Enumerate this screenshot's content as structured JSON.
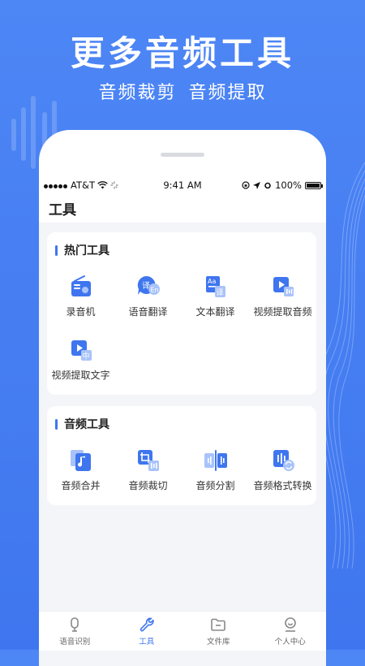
{
  "banner": {
    "title": "更多音频工具",
    "subtitle": "音频裁剪 音频提取"
  },
  "status_bar": {
    "carrier": "AT&T",
    "time": "9:41 AM",
    "battery": "100%"
  },
  "app_bar": {
    "title": "工具"
  },
  "sections": [
    {
      "title": "热门工具",
      "tools": [
        {
          "label": "录音机",
          "icon": "radio-recorder-icon"
        },
        {
          "label": "语音翻译",
          "icon": "speech-translate-icon"
        },
        {
          "label": "文本翻译",
          "icon": "text-translate-icon"
        },
        {
          "label": "视频提取音频",
          "icon": "video-extract-audio-icon"
        },
        {
          "label": "视频提取文字",
          "icon": "video-extract-text-icon"
        }
      ]
    },
    {
      "title": "音频工具",
      "tools": [
        {
          "label": "音频合并",
          "icon": "audio-merge-icon"
        },
        {
          "label": "音频裁切",
          "icon": "audio-crop-icon"
        },
        {
          "label": "音频分割",
          "icon": "audio-split-icon"
        },
        {
          "label": "音频格式转换",
          "icon": "audio-format-convert-icon"
        }
      ]
    }
  ],
  "tab_bar": [
    {
      "label": "语音识别",
      "icon": "microphone-icon",
      "active": false
    },
    {
      "label": "工具",
      "icon": "wrench-icon",
      "active": true
    },
    {
      "label": "文件库",
      "icon": "folder-icon",
      "active": false
    },
    {
      "label": "个人中心",
      "icon": "user-smile-icon",
      "active": false
    }
  ],
  "colors": {
    "accent": "#3f76ef",
    "icon_light": "#a9c3fa",
    "background": "#f4f5f8"
  }
}
